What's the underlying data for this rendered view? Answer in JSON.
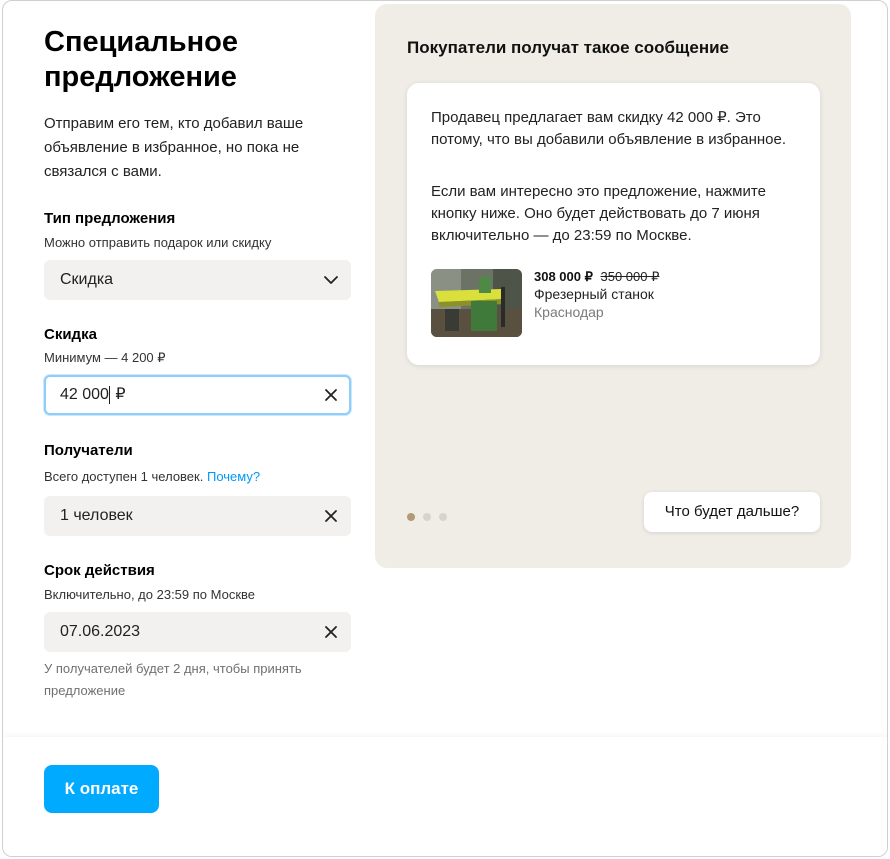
{
  "title": "Специальное предложение",
  "subtitle": "Отправим его тем, кто добавил ваше объявление в избранное, но пока не связался с вами.",
  "offer_type": {
    "label": "Тип предложения",
    "hint": "Можно отправить подарок или скидку",
    "value": "Скидка"
  },
  "discount": {
    "label": "Скидка",
    "hint": "Минимум — 4 200 ₽",
    "value_before_cursor": "42 000",
    "value_after_cursor": " ₽"
  },
  "recipients": {
    "label": "Получатели",
    "hint": "Всего доступен 1 человек.",
    "why_link": "Почему?",
    "value": "1 человек"
  },
  "validity": {
    "label": "Срок действия",
    "hint": "Включительно, до 23:59 по Москве",
    "value": "07.06.2023",
    "note": "У получателей будет 2 дня, чтобы принять предложение"
  },
  "preview": {
    "title": "Покупатели получат такое сообщение",
    "message_p1": "Продавец предлагает вам скидку 42 000 ₽. Это потому, что вы добавили объявление в избранное.",
    "message_p2": "Если вам интересно это предложение, нажмите кнопку ниже. Оно будет действовать до 7 июня включительно — до 23:59 по Москве.",
    "item": {
      "price_new": "308 000 ₽",
      "price_old": "350 000 ₽",
      "name": "Фрезерный станок",
      "city": "Краснодар"
    },
    "next_button": "Что будет дальше?",
    "pagination": {
      "total": 3,
      "active": 1
    }
  },
  "footer": {
    "pay_button": "К оплате"
  },
  "colors": {
    "accent": "#00aaff",
    "link": "#0099f7",
    "panel_bg": "#f0ede7",
    "field_bg": "#f2f1ef"
  },
  "icons": {
    "select": "chevron-down-icon",
    "clear": "close-icon"
  }
}
